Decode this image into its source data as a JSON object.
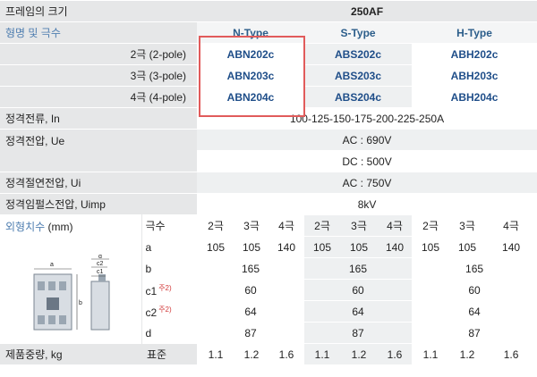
{
  "frame": {
    "label": "프레임의 크기",
    "value": "250AF"
  },
  "poles_header": "형명 및 극수",
  "types": [
    "N-Type",
    "S-Type",
    "H-Type"
  ],
  "models": [
    {
      "pole": "2극 (2-pole)",
      "n": "ABN202c",
      "s": "ABS202c",
      "h": "ABH202c"
    },
    {
      "pole": "3극 (3-pole)",
      "n": "ABN203c",
      "s": "ABS203c",
      "h": "ABH203c"
    },
    {
      "pole": "4극 (4-pole)",
      "n": "ABN204c",
      "s": "ABS204c",
      "h": "ABH204c"
    }
  ],
  "ratings": {
    "current": {
      "label": "정격전류, In",
      "value": "100-125-150-175-200-225-250A"
    },
    "voltage": {
      "label": "정격전압, Ue",
      "ac": "AC : 690V",
      "dc": "DC : 500V"
    },
    "insulation": {
      "label": "정격절연전압, Ui",
      "value": "AC : 750V"
    },
    "impulse": {
      "label": "정격임펄스전압, Uimp",
      "value": "8kV"
    }
  },
  "dimensions": {
    "label": "외형치수",
    "unit": "(mm)",
    "poles_label": "극수",
    "poles": [
      "2극",
      "3극",
      "4극",
      "2극",
      "3극",
      "4극",
      "2극",
      "3극",
      "4극"
    ],
    "a_label": "a",
    "a": [
      "105",
      "105",
      "140",
      "105",
      "105",
      "140",
      "105",
      "105",
      "140"
    ],
    "b_label": "b",
    "b": [
      "165",
      "165",
      "165"
    ],
    "c1_label": "c1",
    "c1_note": "주2)",
    "c1": [
      "60",
      "60",
      "60"
    ],
    "c2_label": "c2",
    "c2_note": "주2)",
    "c2": [
      "64",
      "64",
      "64"
    ],
    "d_label": "d",
    "d": [
      "87",
      "87",
      "87"
    ],
    "drawing_labels": {
      "a": "a",
      "b": "b",
      "c1": "c1",
      "c2": "c2",
      "d": "d"
    }
  },
  "weight": {
    "label": "제품중량, kg",
    "sub": "표준",
    "values": [
      "1.1",
      "1.2",
      "1.6",
      "1.1",
      "1.2",
      "1.6",
      "1.1",
      "1.2",
      "1.6"
    ]
  }
}
